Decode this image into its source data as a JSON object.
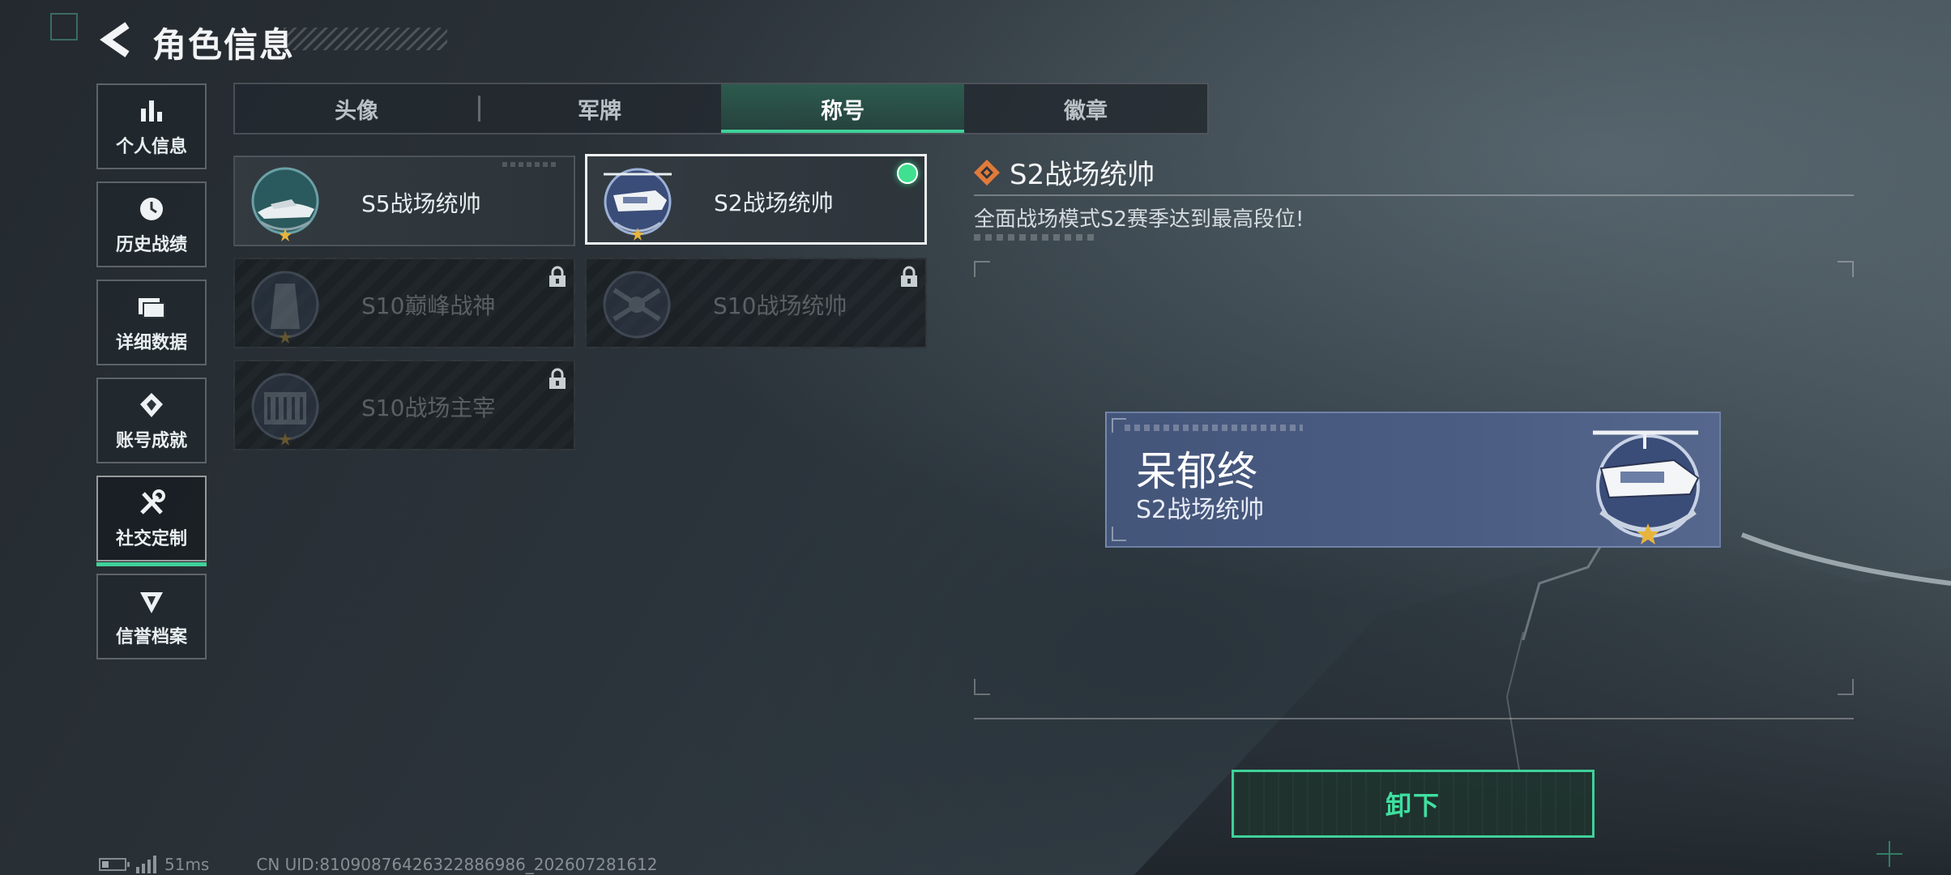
{
  "header": {
    "title": "角色信息"
  },
  "sidebar": {
    "items": [
      {
        "label": "个人信息",
        "icon": "bar-chart-icon"
      },
      {
        "label": "历史战绩",
        "icon": "clock-icon"
      },
      {
        "label": "详细数据",
        "icon": "folder-icon"
      },
      {
        "label": "账号成就",
        "icon": "achievement-icon"
      },
      {
        "label": "社交定制",
        "icon": "tools-icon",
        "active": true
      },
      {
        "label": "信誉档案",
        "icon": "credit-icon"
      }
    ]
  },
  "tabs": [
    {
      "label": "头像"
    },
    {
      "label": "军牌"
    },
    {
      "label": "称号",
      "active": true
    },
    {
      "label": "徽章"
    }
  ],
  "titles": [
    {
      "name": "S5战场统帅",
      "emblem": "boat-emblem-icon",
      "locked": false,
      "selected": false
    },
    {
      "name": "S2战场统帅",
      "emblem": "helicopter-emblem-icon",
      "locked": false,
      "selected": true,
      "equipped": true
    },
    {
      "name": "S10巅峰战神",
      "emblem": "tower-emblem-icon",
      "locked": true
    },
    {
      "name": "S10战场统帅",
      "emblem": "drone-emblem-icon",
      "locked": true
    },
    {
      "name": "S10战场主宰",
      "emblem": "colosseum-emblem-icon",
      "locked": true
    }
  ],
  "detail": {
    "title": "S2战场统帅",
    "description": "全面战场模式S2赛季达到最高段位!",
    "preview": {
      "player_name": "呆郁终",
      "title": "S2战场统帅"
    },
    "action_label": "卸下"
  },
  "status_bar": {
    "ping": "51ms",
    "uid": "CN UID:8109087642632288698​6_202607281612"
  },
  "colors": {
    "accent": "#3fd19a",
    "nameplate": "#4b5d83",
    "title_icon": "#e07a3a"
  }
}
